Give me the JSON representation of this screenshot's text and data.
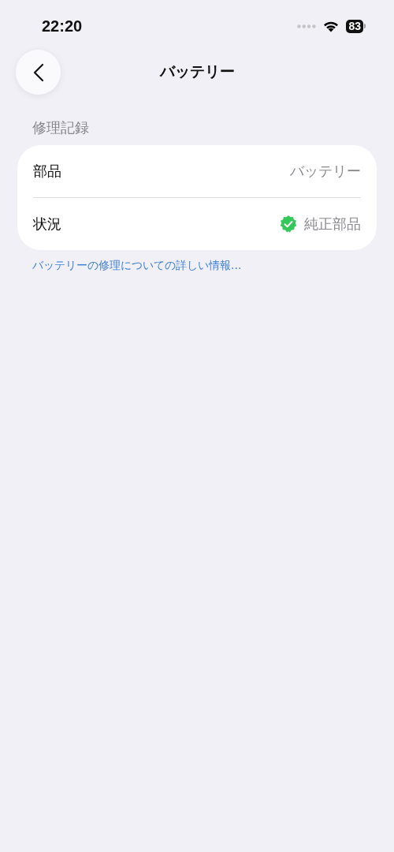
{
  "status_bar": {
    "time": "22:20",
    "battery": "83"
  },
  "nav": {
    "title": "バッテリー"
  },
  "section": {
    "header": "修理記録",
    "rows": [
      {
        "label": "部品",
        "value": "バッテリー",
        "kind": "text"
      },
      {
        "label": "状況",
        "value": "純正部品",
        "kind": "verified"
      }
    ],
    "footer_link": "バッテリーの修理についての詳しい情報..."
  }
}
